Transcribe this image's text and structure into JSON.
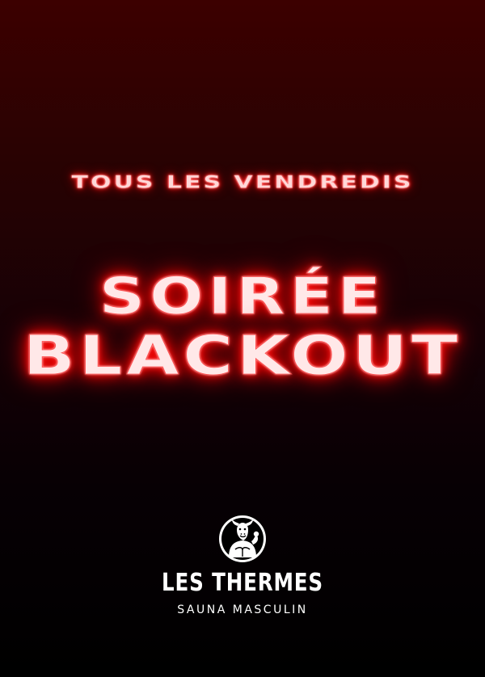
{
  "poster": {
    "tagline": "TOUS LES VENDREDIS",
    "title_line_1": "SOIRÉE",
    "title_line_2": "BLACKOUT",
    "brand": {
      "name": "LES THERMES",
      "subtitle": "SAUNA MASCULIN",
      "logo_icon": "bull-man-icon"
    },
    "colors": {
      "neon_glow": "#ff1a1a",
      "neon_core": "#ffe6e6",
      "background_top": "#3c0000",
      "background_bottom": "#000000",
      "brand_text": "#ffffff"
    }
  }
}
